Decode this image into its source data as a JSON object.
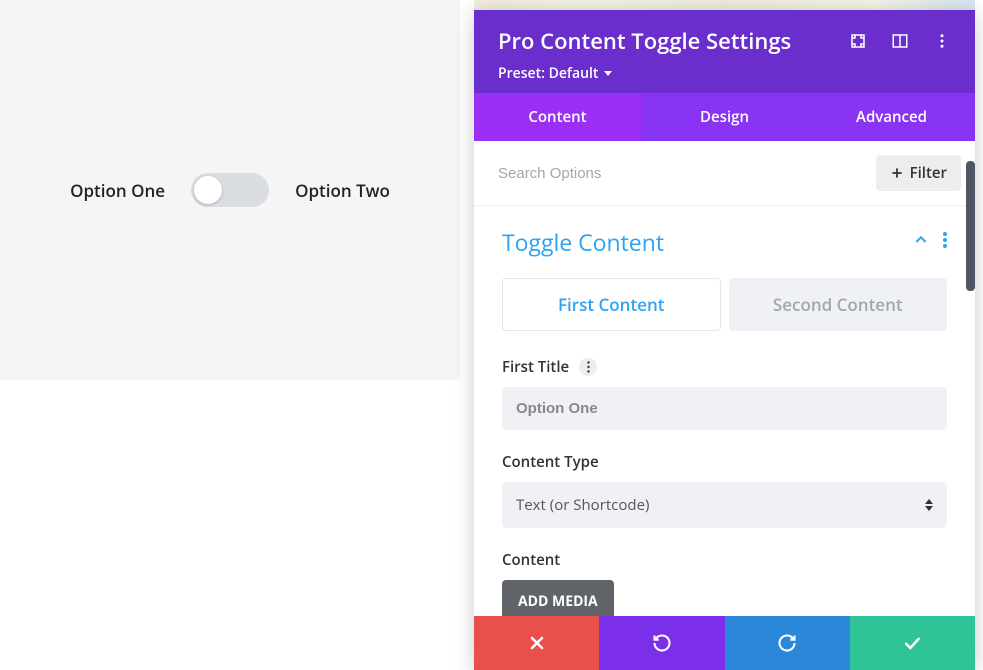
{
  "preview": {
    "option_one": "Option One",
    "option_two": "Option Two"
  },
  "panel": {
    "title": "Pro Content Toggle Settings",
    "preset_label": "Preset: Default"
  },
  "tabs": {
    "content": "Content",
    "design": "Design",
    "advanced": "Advanced"
  },
  "search": {
    "placeholder": "Search Options",
    "filter_label": "Filter"
  },
  "section": {
    "title": "Toggle Content"
  },
  "sub_tabs": {
    "first": "First Content",
    "second": "Second Content"
  },
  "fields": {
    "first_title_label": "First Title",
    "first_title_value": "Option One",
    "content_type_label": "Content Type",
    "content_type_value": "Text (or Shortcode)",
    "content_label": "Content",
    "add_media_label": "ADD MEDIA"
  }
}
